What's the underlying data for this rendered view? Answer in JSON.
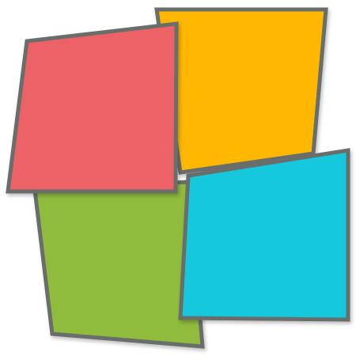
{
  "logo": {
    "stroke_color": "#6b6e6a",
    "tiles": [
      {
        "name": "tile-green",
        "color": "#8fbc3d"
      },
      {
        "name": "tile-yellow",
        "color": "#ffb703"
      },
      {
        "name": "tile-cyan",
        "color": "#13c8dc"
      },
      {
        "name": "tile-red",
        "color": "#ec6266"
      }
    ]
  }
}
